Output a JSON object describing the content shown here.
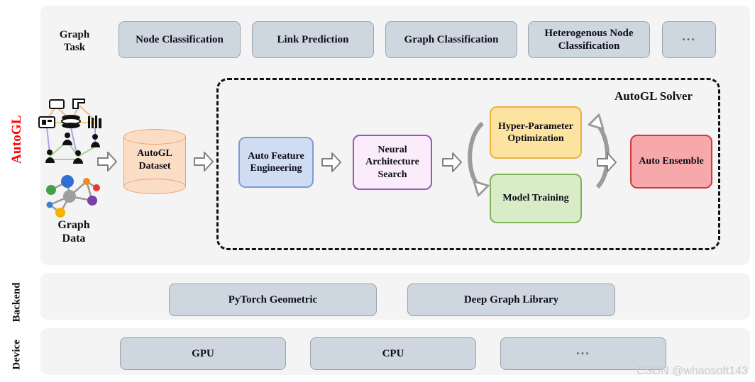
{
  "figure": {
    "watermark": "CSDN @whaosoft143"
  },
  "side_labels": {
    "autogl": "AutoGL",
    "backend": "Backend",
    "device": "Device"
  },
  "graph_task": {
    "caption": "Graph\nTask",
    "caption_line1": "Graph",
    "caption_line2": "Task",
    "items": [
      {
        "label": "Node Classification"
      },
      {
        "label": "Link Prediction"
      },
      {
        "label": "Graph Classification"
      },
      {
        "label": "Heterogenous Node Classification"
      },
      {
        "label": "..."
      }
    ]
  },
  "inputs": {
    "hetero_graph_icon": "heterogeneous-graph-icon",
    "graph_icon": "graph-icon",
    "graph_data_line1": "Graph",
    "graph_data_line2": "Data",
    "dataset_line1": "AutoGL",
    "dataset_line2": "Dataset"
  },
  "solver": {
    "title": "AutoGL Solver",
    "stages": [
      {
        "name": "auto-feature-engineering",
        "label": "Auto Feature Engineering",
        "fill": "#cfdcf2",
        "stroke": "#7a9cd6"
      },
      {
        "name": "neural-architecture-search",
        "label": "Neural Architecture Search",
        "fill": "#faecfb",
        "stroke": "#9a55b8"
      },
      {
        "name": "hyper-parameter-optimization",
        "label": "Hyper-Parameter Optimization",
        "fill": "#fde3a0",
        "stroke": "#e9b33d"
      },
      {
        "name": "model-training",
        "label": "Model Training",
        "fill": "#d9ecc8",
        "stroke": "#7cb456"
      },
      {
        "name": "auto-ensemble",
        "label": "Auto Ensemble",
        "fill": "#f7a8ab",
        "stroke": "#d4383f"
      }
    ]
  },
  "backend": {
    "items": [
      {
        "label": "PyTorch Geometric"
      },
      {
        "label": "Deep Graph Library"
      }
    ]
  },
  "device": {
    "items": [
      {
        "label": "GPU"
      },
      {
        "label": "CPU"
      },
      {
        "label": "..."
      }
    ]
  },
  "colors": {
    "panel_bg": "#f4f4f4",
    "pill_fill": "#ced6e0",
    "pill_stroke": "#9aa3ad",
    "autogl_red": "#ff0000",
    "dataset_fill": "#fbddc5",
    "dataset_stroke": "#e8a070",
    "dashed_border": "#111111"
  }
}
